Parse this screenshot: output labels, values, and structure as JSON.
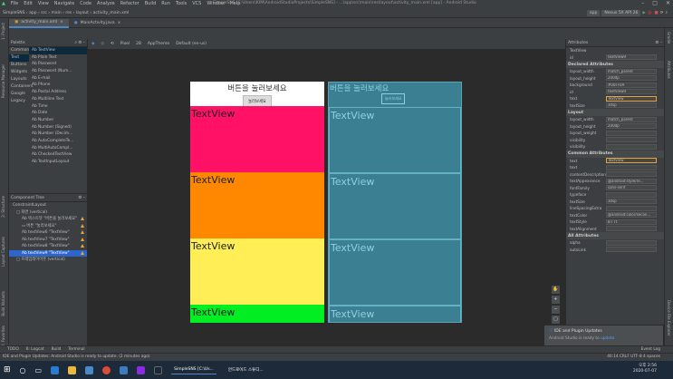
{
  "menu": [
    "File",
    "Edit",
    "View",
    "Navigate",
    "Code",
    "Analyze",
    "Refactor",
    "Build",
    "Run",
    "Tools",
    "VCS",
    "Window",
    "Help"
  ],
  "window_title": "SimpleSNS [C:\\Users\\KIM\\AndroidStudioProjects\\SimpleSNS] - ...\\app\\src\\main\\res\\layout\\activity_main.xml [app] - Android Studio",
  "navbar": {
    "crumbs": [
      "SimpleSNS",
      "app",
      "src",
      "main",
      "res",
      "layout",
      "activity_main.xml"
    ],
    "run_config": "app",
    "device": "Nexus 5X API 26"
  },
  "editor_tabs": [
    "activity_main.xml",
    "MainActivity.java"
  ],
  "left_strip": [
    "1: Project",
    "Resource Manager",
    "Layout Captures",
    "2: Structure",
    "Build Variants",
    "2: Favorites"
  ],
  "right_strip": [
    "Gradle",
    "Attributes",
    "Device File Explorer",
    "Emulator"
  ],
  "palette": {
    "title": "Palette",
    "categories": [
      "Common",
      "Text",
      "Buttons",
      "Widgets",
      "Layouts",
      "Containers",
      "Google",
      "Legacy"
    ],
    "selected_category": "Text",
    "items": [
      "TextView",
      "Plain Text",
      "Password",
      "Password (Num...",
      "E-mail",
      "Phone",
      "Postal Address",
      "Multiline Text",
      "Time",
      "Date",
      "Number",
      "Number (Signed)",
      "Number (Decim...",
      "AutoCompleteTe...",
      "MultiAutoCompl...",
      "CheckedTextView",
      "TextInputLayout"
    ]
  },
  "component_tree": {
    "title": "Component Tree",
    "rows": [
      {
        "label": "ConstraintLayout",
        "indent": 4,
        "warn": false,
        "sel": false
      },
      {
        "label": "□ 화면  (vertical)",
        "indent": 8,
        "warn": false,
        "sel": false
      },
      {
        "label": "Ab 텍스트뷰  \"버튼을 눌러보세요\"",
        "indent": 14,
        "warn": true,
        "sel": false
      },
      {
        "label": "▭ 버튼  \"눌러보세요\"",
        "indent": 14,
        "warn": true,
        "sel": false
      },
      {
        "label": "Ab textView6  \"TextView\"",
        "indent": 14,
        "warn": true,
        "sel": false
      },
      {
        "label": "Ab textView7  \"TextView\"",
        "indent": 14,
        "warn": true,
        "sel": false
      },
      {
        "label": "Ab textView8  \"TextView\"",
        "indent": 14,
        "warn": true,
        "sel": false
      },
      {
        "label": "Ab textView9  \"TextView\"",
        "indent": 14,
        "warn": true,
        "sel": true
      },
      {
        "label": "□ 프레임레이아웃  (vertical)",
        "indent": 8,
        "warn": false,
        "sel": false
      }
    ]
  },
  "design_toolbar": [
    "Pixel",
    "28",
    "AppTheme",
    "Default (en-us)"
  ],
  "preview": {
    "title_text": "버튼을 눌러보세요",
    "button_text": "눌러보세요",
    "textviews": [
      "TextView",
      "TextView",
      "TextView",
      "TextView"
    ],
    "colors": [
      "#ff1166",
      "#ff8800",
      "#ffee55",
      "#00ee22"
    ]
  },
  "attributes": {
    "title": "Attributes",
    "widget": "TextView",
    "id_label": "id",
    "id_value": "textView9",
    "declared_title": "Declared Attributes",
    "declared": [
      {
        "k": "layout_width",
        "v": "match_parent"
      },
      {
        "k": "layout_height",
        "v": "200dp"
      },
      {
        "k": "background",
        "v": "#00FF0A"
      },
      {
        "k": "id",
        "v": "textView9"
      },
      {
        "k": "text",
        "v": "TextView"
      },
      {
        "k": "textSize",
        "v": "30sp"
      }
    ],
    "layout_title": "Layout",
    "layout": [
      {
        "k": "layout_width",
        "v": "match_parent"
      },
      {
        "k": "layout_height",
        "v": "200dp"
      },
      {
        "k": "layout_weight",
        "v": ""
      },
      {
        "k": "visibility",
        "v": ""
      },
      {
        "k": "visibility",
        "v": ""
      }
    ],
    "common_title": "Common Attributes",
    "common": [
      {
        "k": "text",
        "v": "TextView"
      },
      {
        "k": "text",
        "v": ""
      },
      {
        "k": "contentDescription",
        "v": ""
      },
      {
        "k": "textAppearance",
        "v": "@android:style/Te..."
      },
      {
        "k": "fontFamily",
        "v": "sans-serif"
      },
      {
        "k": "typeface",
        "v": ""
      },
      {
        "k": "textSize",
        "v": "30sp"
      },
      {
        "k": "lineSpacingExtra",
        "v": ""
      },
      {
        "k": "textColor",
        "v": "@android:color/secon..."
      },
      {
        "k": "textStyle",
        "v": "B  I  Tt"
      },
      {
        "k": "textAlignment",
        "v": ""
      }
    ],
    "all_title": "All Attributes",
    "all": [
      {
        "k": "alpha",
        "v": ""
      },
      {
        "k": "autoLink",
        "v": ""
      }
    ]
  },
  "notification": {
    "title": "IDE and Plugin Updates",
    "body": "Android Studio is ready to",
    "link": "update."
  },
  "bottom_tabs": [
    "TODO",
    "6: Logcat",
    "Build",
    "Terminal"
  ],
  "event_log": "Event Log",
  "status_text": "IDE and Plugin Updates: Android Studio is ready to update. (2 minutes ago)",
  "status_right": "40:14  CRLF  UTF-8  4 spaces",
  "taskbar": {
    "items": [
      "SimpleSNS [C:\\Us...",
      "안드로이드 스튜디..."
    ],
    "time": "오후 2:56",
    "date": "2020-07-07"
  }
}
